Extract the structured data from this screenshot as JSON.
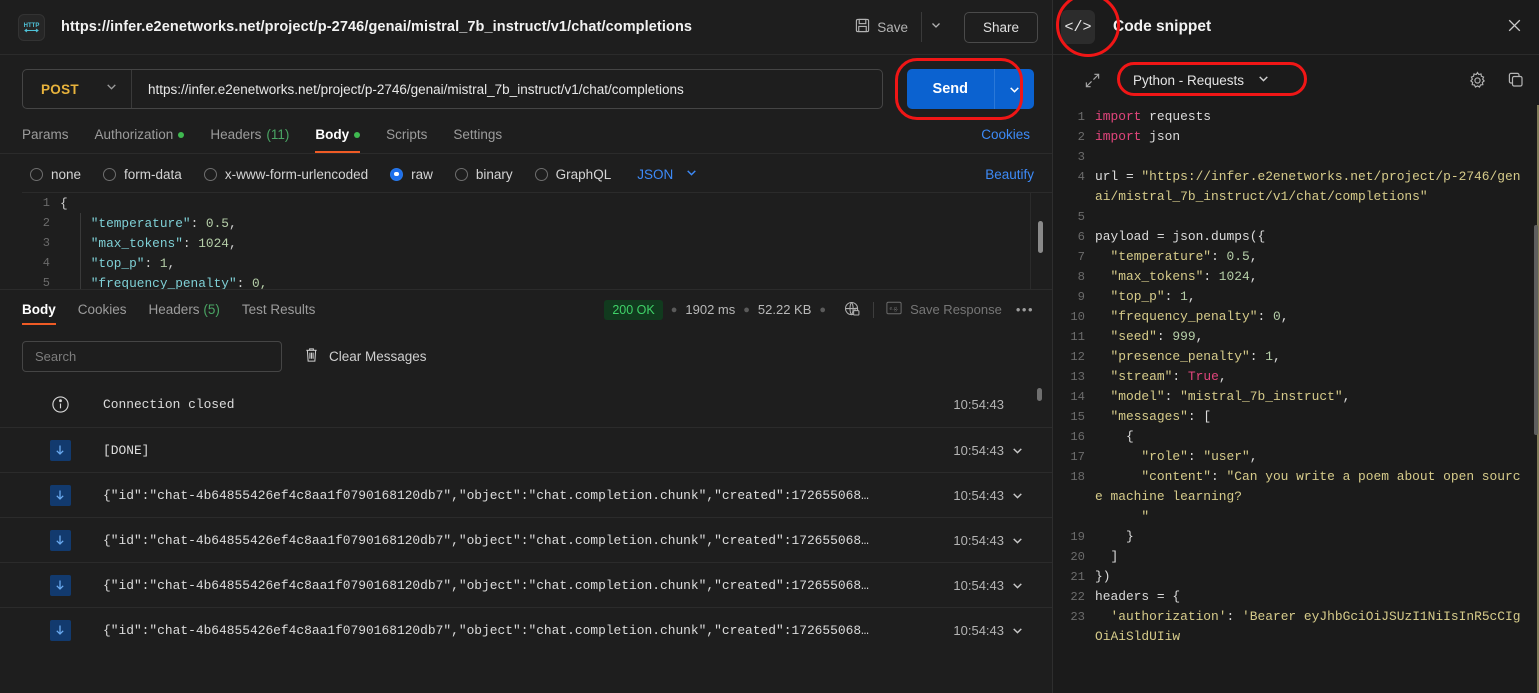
{
  "request": {
    "title": "https://infer.e2enetworks.net/project/p-2746/genai/mistral_7b_instruct/v1/chat/completions",
    "http_badge_label": "HTTP",
    "save_label": "Save",
    "share_label": "Share",
    "method": "POST",
    "url": "https://infer.e2enetworks.net/project/p-2746/genai/mistral_7b_instruct/v1/chat/completions",
    "send_label": "Send",
    "tabs": [
      {
        "label": "Params",
        "dot": false,
        "count": "",
        "active": false
      },
      {
        "label": "Authorization",
        "dot": true,
        "count": "",
        "active": false
      },
      {
        "label": "Headers",
        "dot": false,
        "count": "(11)",
        "active": false
      },
      {
        "label": "Body",
        "dot": true,
        "count": "",
        "active": true
      },
      {
        "label": "Scripts",
        "dot": false,
        "count": "",
        "active": false
      },
      {
        "label": "Settings",
        "dot": false,
        "count": "",
        "active": false
      }
    ],
    "cookies_link": "Cookies",
    "body_types": [
      {
        "label": "none",
        "selected": false
      },
      {
        "label": "form-data",
        "selected": false
      },
      {
        "label": "x-www-form-urlencoded",
        "selected": false
      },
      {
        "label": "raw",
        "selected": true
      },
      {
        "label": "binary",
        "selected": false
      },
      {
        "label": "GraphQL",
        "selected": false
      }
    ],
    "body_format": "JSON",
    "beautify_label": "Beautify",
    "body_lines": [
      {
        "n": "1",
        "segs": [
          {
            "t": "{",
            "c": "c-brace"
          }
        ]
      },
      {
        "n": "2",
        "segs": [
          {
            "t": "    \"temperature\"",
            "c": "c-key"
          },
          {
            "t": ": ",
            "c": "c-punct"
          },
          {
            "t": "0.5",
            "c": "c-num"
          },
          {
            "t": ",",
            "c": "c-punct"
          }
        ]
      },
      {
        "n": "3",
        "segs": [
          {
            "t": "    \"max_tokens\"",
            "c": "c-key"
          },
          {
            "t": ": ",
            "c": "c-punct"
          },
          {
            "t": "1024",
            "c": "c-num"
          },
          {
            "t": ",",
            "c": "c-punct"
          }
        ]
      },
      {
        "n": "4",
        "segs": [
          {
            "t": "    \"top_p\"",
            "c": "c-key"
          },
          {
            "t": ": ",
            "c": "c-punct"
          },
          {
            "t": "1",
            "c": "c-num"
          },
          {
            "t": ",",
            "c": "c-punct"
          }
        ]
      },
      {
        "n": "5",
        "segs": [
          {
            "t": "    \"frequency_penalty\"",
            "c": "c-key"
          },
          {
            "t": ": ",
            "c": "c-punct"
          },
          {
            "t": "0,",
            "c": "c-num"
          }
        ]
      }
    ]
  },
  "response": {
    "tabs": [
      {
        "label": "Body",
        "count": "",
        "active": true
      },
      {
        "label": "Cookies",
        "count": "",
        "active": false
      },
      {
        "label": "Headers",
        "count": "(5)",
        "active": false
      },
      {
        "label": "Test Results",
        "count": "",
        "active": false
      }
    ],
    "status": "200 OK",
    "time": "1902 ms",
    "size": "52.22 KB",
    "save_response_label": "Save Response",
    "search_placeholder": "Search",
    "clear_messages_label": "Clear Messages",
    "messages": [
      {
        "icon": "info",
        "text": "Connection closed",
        "time": "10:54:43",
        "caret": false
      },
      {
        "icon": "down",
        "text": "[DONE]",
        "time": "10:54:43",
        "caret": true
      },
      {
        "icon": "down",
        "text": "{\"id\":\"chat-4b64855426ef4c8aa1f0790168120db7\",\"object\":\"chat.completion.chunk\",\"created\":172655068…",
        "time": "10:54:43",
        "caret": true
      },
      {
        "icon": "down",
        "text": "{\"id\":\"chat-4b64855426ef4c8aa1f0790168120db7\",\"object\":\"chat.completion.chunk\",\"created\":172655068…",
        "time": "10:54:43",
        "caret": true
      },
      {
        "icon": "down",
        "text": "{\"id\":\"chat-4b64855426ef4c8aa1f0790168120db7\",\"object\":\"chat.completion.chunk\",\"created\":172655068…",
        "time": "10:54:43",
        "caret": true
      },
      {
        "icon": "down",
        "text": "{\"id\":\"chat-4b64855426ef4c8aa1f0790168120db7\",\"object\":\"chat.completion.chunk\",\"created\":172655068…",
        "time": "10:54:43",
        "caret": true
      }
    ]
  },
  "snippet": {
    "title": "Code snippet",
    "language": "Python - Requests",
    "lines": [
      {
        "n": "1",
        "segs": [
          {
            "t": "import ",
            "c": "k-kw"
          },
          {
            "t": "requests",
            "c": "k-plain"
          }
        ]
      },
      {
        "n": "2",
        "segs": [
          {
            "t": "import ",
            "c": "k-kw"
          },
          {
            "t": "json",
            "c": "k-plain"
          }
        ]
      },
      {
        "n": "3",
        "segs": [
          {
            "t": "",
            "c": "k-plain"
          }
        ]
      },
      {
        "n": "4",
        "segs": [
          {
            "t": "url = ",
            "c": "k-plain"
          },
          {
            "t": "\"https://infer.e2enetworks.net/project/p-2746/genai/mistral_7b_instruct/v1/chat/completions\"",
            "c": "k-str"
          }
        ]
      },
      {
        "n": "5",
        "segs": [
          {
            "t": "",
            "c": "k-plain"
          }
        ]
      },
      {
        "n": "6",
        "segs": [
          {
            "t": "payload = json.dumps({",
            "c": "k-plain"
          }
        ]
      },
      {
        "n": "7",
        "segs": [
          {
            "t": "  \"temperature\"",
            "c": "k-str"
          },
          {
            "t": ": ",
            "c": "k-plain"
          },
          {
            "t": "0.5",
            "c": "k-num"
          },
          {
            "t": ",",
            "c": "k-plain"
          }
        ]
      },
      {
        "n": "8",
        "segs": [
          {
            "t": "  \"max_tokens\"",
            "c": "k-str"
          },
          {
            "t": ": ",
            "c": "k-plain"
          },
          {
            "t": "1024",
            "c": "k-num"
          },
          {
            "t": ",",
            "c": "k-plain"
          }
        ]
      },
      {
        "n": "9",
        "segs": [
          {
            "t": "  \"top_p\"",
            "c": "k-str"
          },
          {
            "t": ": ",
            "c": "k-plain"
          },
          {
            "t": "1",
            "c": "k-num"
          },
          {
            "t": ",",
            "c": "k-plain"
          }
        ]
      },
      {
        "n": "10",
        "segs": [
          {
            "t": "  \"frequency_penalty\"",
            "c": "k-str"
          },
          {
            "t": ": ",
            "c": "k-plain"
          },
          {
            "t": "0",
            "c": "k-num"
          },
          {
            "t": ",",
            "c": "k-plain"
          }
        ]
      },
      {
        "n": "11",
        "segs": [
          {
            "t": "  \"seed\"",
            "c": "k-str"
          },
          {
            "t": ": ",
            "c": "k-plain"
          },
          {
            "t": "999",
            "c": "k-num"
          },
          {
            "t": ",",
            "c": "k-plain"
          }
        ]
      },
      {
        "n": "12",
        "segs": [
          {
            "t": "  \"presence_penalty\"",
            "c": "k-str"
          },
          {
            "t": ": ",
            "c": "k-plain"
          },
          {
            "t": "1",
            "c": "k-num"
          },
          {
            "t": ",",
            "c": "k-plain"
          }
        ]
      },
      {
        "n": "13",
        "segs": [
          {
            "t": "  \"stream\"",
            "c": "k-str"
          },
          {
            "t": ": ",
            "c": "k-plain"
          },
          {
            "t": "True",
            "c": "k-kw"
          },
          {
            "t": ",",
            "c": "k-plain"
          }
        ]
      },
      {
        "n": "14",
        "segs": [
          {
            "t": "  \"model\"",
            "c": "k-str"
          },
          {
            "t": ": ",
            "c": "k-plain"
          },
          {
            "t": "\"mistral_7b_instruct\"",
            "c": "k-str"
          },
          {
            "t": ",",
            "c": "k-plain"
          }
        ]
      },
      {
        "n": "15",
        "segs": [
          {
            "t": "  \"messages\"",
            "c": "k-str"
          },
          {
            "t": ": [",
            "c": "k-plain"
          }
        ]
      },
      {
        "n": "16",
        "segs": [
          {
            "t": "    {",
            "c": "k-plain"
          }
        ]
      },
      {
        "n": "17",
        "segs": [
          {
            "t": "      \"role\"",
            "c": "k-str"
          },
          {
            "t": ": ",
            "c": "k-plain"
          },
          {
            "t": "\"user\"",
            "c": "k-str"
          },
          {
            "t": ",",
            "c": "k-plain"
          }
        ]
      },
      {
        "n": "18",
        "segs": [
          {
            "t": "      \"content\"",
            "c": "k-str"
          },
          {
            "t": ": ",
            "c": "k-plain"
          },
          {
            "t": "\"Can you write a poem about open source machine learning?\n      \"",
            "c": "k-str"
          }
        ]
      },
      {
        "n": "19",
        "segs": [
          {
            "t": "    }",
            "c": "k-plain"
          }
        ]
      },
      {
        "n": "20",
        "segs": [
          {
            "t": "  ]",
            "c": "k-plain"
          }
        ]
      },
      {
        "n": "21",
        "segs": [
          {
            "t": "})",
            "c": "k-plain"
          }
        ]
      },
      {
        "n": "22",
        "segs": [
          {
            "t": "headers = {",
            "c": "k-plain"
          }
        ]
      },
      {
        "n": "23",
        "segs": [
          {
            "t": "  'authorization'",
            "c": "k-str"
          },
          {
            "t": ": ",
            "c": "k-plain"
          },
          {
            "t": "'Bearer eyJhbGciOiJSUzI1NiIsInR5cCIgOiAiSldUIiw",
            "c": "k-str"
          }
        ]
      }
    ]
  },
  "colors": {
    "accent_blue": "#0b62d0",
    "tab_underline": "#ef5b25",
    "highlight_red": "#f01616",
    "status_green": "#3fd168",
    "method_yellow": "#e8b33c",
    "link_blue": "#3d8af7"
  }
}
